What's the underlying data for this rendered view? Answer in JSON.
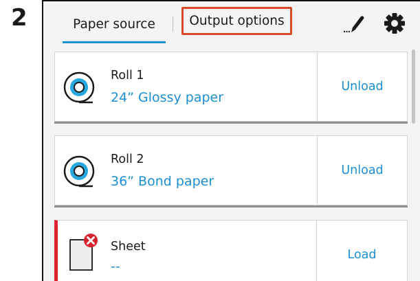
{
  "step_number": "2",
  "tabs": {
    "paper_source": "Paper source",
    "output_options": "Output options"
  },
  "toolbar": {
    "edit_icon": "edit-pen-icon",
    "settings_icon": "gear-icon"
  },
  "highlight_color": "#d94a2b",
  "accent_color": "#1b8fd1",
  "error_color": "#d6232f",
  "cards": [
    {
      "title": "Roll 1",
      "subtitle": "24” Glossy paper",
      "action": "Unload",
      "icon": "paper-roll-icon"
    },
    {
      "title": "Roll 2",
      "subtitle": "36” Bond paper",
      "action": "Unload",
      "icon": "paper-roll-icon"
    },
    {
      "title": "Sheet",
      "subtitle": "--",
      "action": "Load",
      "icon": "sheet-icon",
      "status": "error"
    }
  ]
}
